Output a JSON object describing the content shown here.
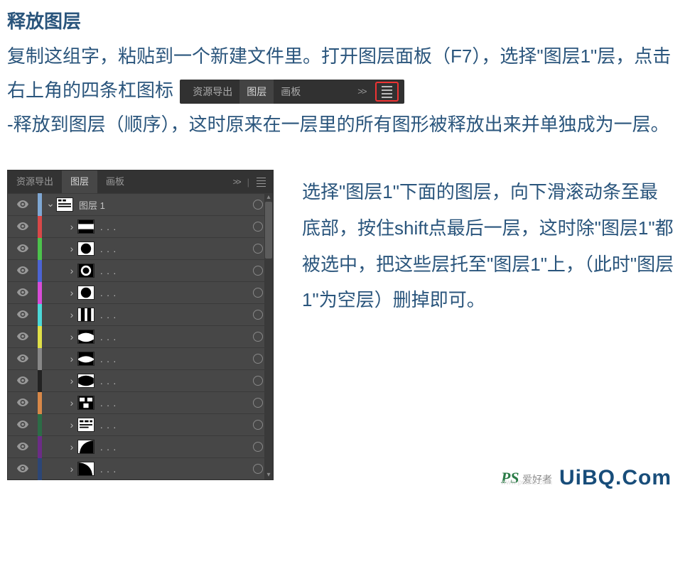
{
  "heading": "释放图层",
  "para1_segA": "复制这组字，粘贴到一个新建文件里。打开图层面板（F7），选择\"图层1\"层，点击右上角的四条杠图标 ",
  "para1_segB": "-释放到图层（顺序），这时原来在一层里的所有图形被释放出来并单独成为一层。",
  "inline_panel": {
    "tab1": "资源导出",
    "tab2": "图层",
    "tab3": "画板",
    "chevron": ">>"
  },
  "layer_panel": {
    "tab1": "资源导出",
    "tab2": "图层",
    "tab3": "画板",
    "chevron": ">>",
    "root_label": "图层 1",
    "rows": [
      {
        "color": "#7fa8d4",
        "thumb": "root"
      },
      {
        "color": "#d84848",
        "thumb": "hstripe"
      },
      {
        "color": "#4cc24c",
        "thumb": "circle"
      },
      {
        "color": "#4c64d4",
        "thumb": "circle-cut"
      },
      {
        "color": "#d84cd8",
        "thumb": "circle"
      },
      {
        "color": "#4cd8d8",
        "thumb": "vstripe"
      },
      {
        "color": "#e0e048",
        "thumb": "curve-top"
      },
      {
        "color": "#888888",
        "thumb": "curve-top2"
      },
      {
        "color": "#222222",
        "thumb": "curve"
      },
      {
        "color": "#d88848",
        "thumb": "squares"
      },
      {
        "color": "#2c6c46",
        "thumb": "text"
      },
      {
        "color": "#6c2c86",
        "thumb": "quarter1"
      },
      {
        "color": "#2c4676",
        "thumb": "quarter2"
      }
    ]
  },
  "right_para": "选择\"图层1\"下面的图层，向下滑滚动条至最底部，按住shift点最后一层，这时除\"图层1\"都被选中，把这些层托至\"图层1\"上，（此时\"图层1\"为空层）删掉即可。",
  "watermark": {
    "ps": "PS",
    "cn": "爱好者",
    "faint": "www.psahz.com",
    "uibq": "UiBQ.Com"
  }
}
